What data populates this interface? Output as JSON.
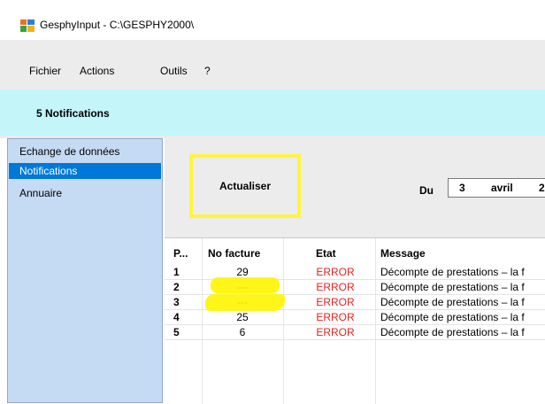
{
  "window": {
    "title": "GesphyInput - C:\\GESPHY2000\\"
  },
  "menu": [
    "Fichier",
    "Actions",
    "Outils",
    "?"
  ],
  "notification_header": "5 Notifications",
  "sidebar": {
    "items": [
      {
        "label": "Echange de données",
        "selected": false
      },
      {
        "label": "Notifications",
        "selected": true
      },
      {
        "label": "Annuaire",
        "selected": false
      }
    ]
  },
  "toolbar": {
    "refresh_label": "Actualiser",
    "du_label": "Du",
    "date_day": "3",
    "date_month": "avril",
    "date_year_partial": "2"
  },
  "table": {
    "columns": [
      "P...",
      "No facture",
      "Etat",
      "Message"
    ],
    "rows": [
      {
        "p": "1",
        "facture": "29",
        "etat": "ERROR",
        "message": "Décompte de prestations – la f"
      },
      {
        "p": "2",
        "facture": "---",
        "etat": "ERROR",
        "message": "Décompte de prestations – la f"
      },
      {
        "p": "3",
        "facture": "---",
        "etat": "ERROR",
        "message": "Décompte de prestations – la f"
      },
      {
        "p": "4",
        "facture": "25",
        "etat": "ERROR",
        "message": "Décompte de prestations – la f"
      },
      {
        "p": "5",
        "facture": "6",
        "etat": "ERROR",
        "message": "Décompte de prestations – la f"
      }
    ]
  },
  "colors": {
    "notification_bar": "#c3f5f9",
    "sidebar": "#c5daf3",
    "selection": "#0078d7",
    "error": "#e8201c",
    "highlight": "#fff53a"
  }
}
